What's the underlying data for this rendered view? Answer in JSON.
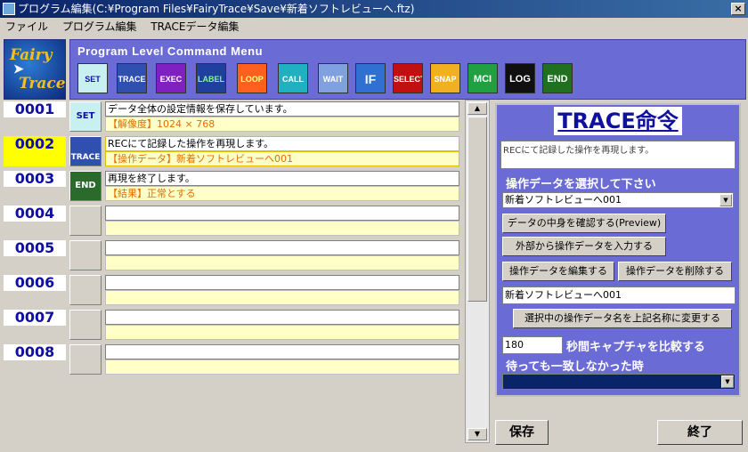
{
  "window": {
    "title": "プログラム編集(C:¥Program Files¥FairyTrace¥Save¥新着ソフトレビューへ.ftz)",
    "close_label": "×"
  },
  "menu": [
    "ファイル",
    "プログラム編集",
    "TRACEデータ編集"
  ],
  "logo": {
    "line1": "Fairy",
    "line2": "Trace"
  },
  "command_menu": {
    "title": "Program Level Command Menu",
    "buttons": [
      "SET",
      "TRACE",
      "EXEC",
      "LABEL",
      "LOOP",
      "CALL",
      "WAIT",
      "IF",
      "SELECT",
      "SNAP",
      "MCI",
      "LOG",
      "END"
    ]
  },
  "rows": [
    {
      "num": "0001",
      "cmd": "SET",
      "line1": "データ全体の設定情報を保存しています。",
      "line2": "【解像度】1024 × 768"
    },
    {
      "num": "0002",
      "cmd": "TRACE",
      "line1": "RECにて記録した操作を再現します。",
      "line2": "【操作データ】新着ソフトレビューへ001"
    },
    {
      "num": "0003",
      "cmd": "END",
      "line1": "再現を終了します。",
      "line2": "【結果】正常とする"
    },
    {
      "num": "0004",
      "cmd": "",
      "line1": "",
      "line2": ""
    },
    {
      "num": "0005",
      "cmd": "",
      "line1": "",
      "line2": ""
    },
    {
      "num": "0006",
      "cmd": "",
      "line1": "",
      "line2": ""
    },
    {
      "num": "0007",
      "cmd": "",
      "line1": "",
      "line2": ""
    },
    {
      "num": "0008",
      "cmd": "",
      "line1": "",
      "line2": ""
    }
  ],
  "panel": {
    "title": "TRACE命令",
    "description": "RECにて記録した操作を再現します。",
    "select_label": "操作データを選択して下さい",
    "selected_data": "新着ソフトレビューへ001",
    "preview_button": "データの中身を確認する(Preview)",
    "import_button": "外部から操作データを入力する",
    "edit_button": "操作データを編集する",
    "delete_button": "操作データを削除する",
    "name_field": "新着ソフトレビューへ001",
    "rename_button": "選択中の操作データ名を上記名称に変更する",
    "capture_seconds": "180",
    "capture_label": "秒間キャプチャを比較する",
    "timeout_label": "待っても一致しなかった時",
    "timeout_value": ""
  },
  "save_button": "保存",
  "exit_button": "終了",
  "colors": {
    "panel_bg": "#6b6bd6",
    "highlight": "#ffff00",
    "number_text": "#1010a0",
    "detail_text": "#e07000"
  }
}
